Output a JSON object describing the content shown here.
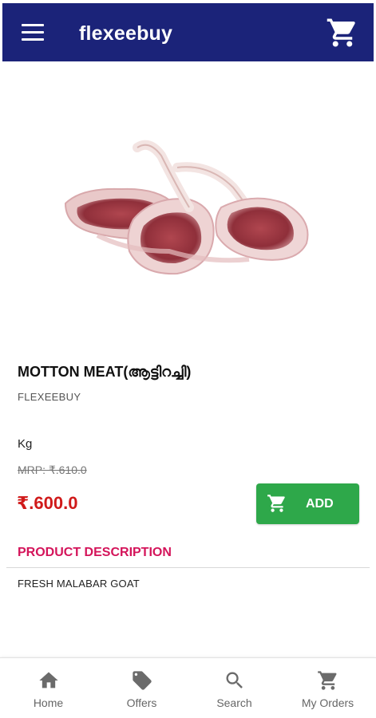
{
  "header": {
    "title": "flexeebuy",
    "menu_icon": "menu-icon",
    "cart_icon": "cart-icon",
    "background": "#1b2379"
  },
  "product": {
    "image": "meat-cutlets-image",
    "name": "MOTTON MEAT(ആട്ടിറച്ചി)",
    "brand": "FLEXEEBUY",
    "unit": "Kg",
    "mrp": "MRP: ₹.610.0",
    "price": "₹.600.0",
    "price_color": "#d01a1a",
    "add_button": {
      "label": "ADD",
      "icon": "cart-icon",
      "color": "#2ea84a"
    }
  },
  "description": {
    "heading": "PRODUCT DESCRIPTION",
    "heading_color": "#d4145a",
    "text": "FRESH MALABAR GOAT"
  },
  "bottom_nav": {
    "items": [
      {
        "label": "Home",
        "icon": "home-icon"
      },
      {
        "label": "Offers",
        "icon": "tag-icon"
      },
      {
        "label": "Search",
        "icon": "search-icon"
      },
      {
        "label": "My Orders",
        "icon": "cart-icon"
      }
    ]
  }
}
